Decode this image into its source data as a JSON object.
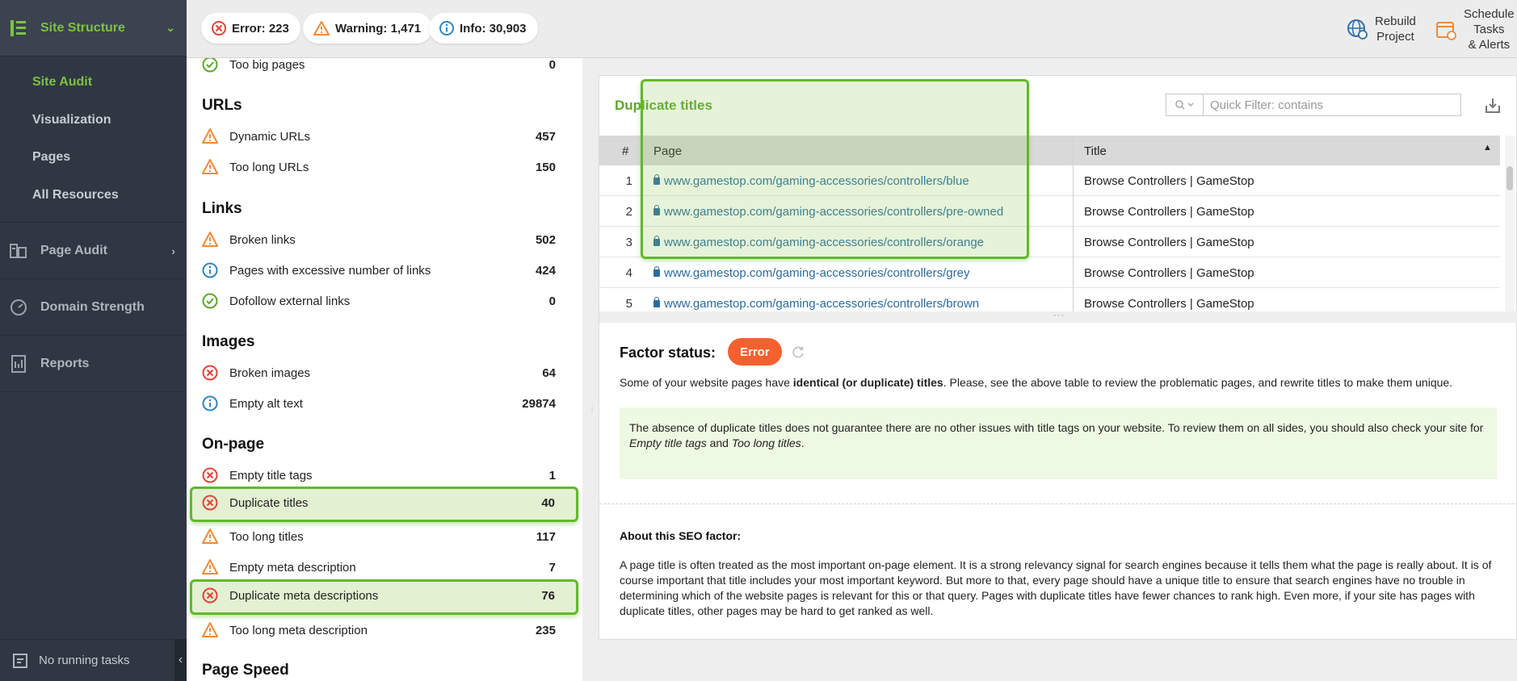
{
  "nav": {
    "site_structure": "Site Structure",
    "subs": [
      "Site Audit",
      "Visualization",
      "Pages",
      "All Resources"
    ],
    "page_audit": "Page Audit",
    "domain_strength": "Domain Strength",
    "reports": "Reports",
    "footer": "No running tasks"
  },
  "topbar": {
    "error": "Error: 223",
    "warning": "Warning: 1,471",
    "info": "Info: 30,903",
    "rebuild_l1": "Rebuild",
    "rebuild_l2": "Project",
    "schedule_l1": "Schedule",
    "schedule_l2": "Tasks",
    "schedule_l3": "& Alerts"
  },
  "factors": {
    "too_big": {
      "label": "Too big pages",
      "value": "0"
    },
    "urls": "URLs",
    "dynamic_urls": {
      "label": "Dynamic URLs",
      "value": "457"
    },
    "long_urls": {
      "label": "Too long URLs",
      "value": "150"
    },
    "links": "Links",
    "broken_links": {
      "label": "Broken links",
      "value": "502"
    },
    "excessive_links": {
      "label": "Pages with excessive number of links",
      "value": "424"
    },
    "dofollow": {
      "label": "Dofollow external links",
      "value": "0"
    },
    "images": "Images",
    "broken_images": {
      "label": "Broken images",
      "value": "64"
    },
    "empty_alt": {
      "label": "Empty alt text",
      "value": "29874"
    },
    "onpage": "On-page",
    "empty_title": {
      "label": "Empty title tags",
      "value": "1"
    },
    "dup_titles": {
      "label": "Duplicate titles",
      "value": "40"
    },
    "long_titles": {
      "label": "Too long titles",
      "value": "117"
    },
    "empty_meta": {
      "label": "Empty meta description",
      "value": "7"
    },
    "dup_meta": {
      "label": "Duplicate meta descriptions",
      "value": "76"
    },
    "long_meta": {
      "label": "Too long meta description",
      "value": "235"
    },
    "page_speed": "Page Speed"
  },
  "detail": {
    "title": "Duplicate titles",
    "filter_placeholder": "Quick Filter: contains",
    "col_num": "#",
    "col_page": "Page",
    "col_title": "Title",
    "rows": [
      {
        "n": "1",
        "page": "www.gamestop.com/gaming-accessories/controllers/blue",
        "title": "Browse Controllers | GameStop"
      },
      {
        "n": "2",
        "page": "www.gamestop.com/gaming-accessories/controllers/pre-owned",
        "title": "Browse Controllers | GameStop"
      },
      {
        "n": "3",
        "page": "www.gamestop.com/gaming-accessories/controllers/orange",
        "title": "Browse Controllers | GameStop"
      },
      {
        "n": "4",
        "page": "www.gamestop.com/gaming-accessories/controllers/grey",
        "title": "Browse Controllers | GameStop"
      },
      {
        "n": "5",
        "page": "www.gamestop.com/gaming-accessories/controllers/brown",
        "title": "Browse Controllers | GameStop"
      }
    ],
    "factor_status_label": "Factor status:",
    "factor_status": "Error",
    "status_text_1": "Some of your website pages have ",
    "status_text_bold": "identical (or duplicate) titles",
    "status_text_2": ". Please, see the above table to review the problematic pages, and rewrite titles to make them unique.",
    "tip_1": "The absence of duplicate titles does not guarantee there are no other issues with title tags on your website. To review them on all sides, you should also check your site for ",
    "tip_em1": "Empty title tags",
    "tip_and": " and ",
    "tip_em2": "Too long titles",
    "tip_end": ".",
    "about_title": "About this SEO factor:",
    "about_text": "A page title is often treated as the most important on-page element. It is a strong relevancy signal for search engines because it tells them what the page is really about. It is of course important that title includes your most important keyword. But more to that, every page should have a unique title to ensure that search engines have no trouble in determining which of the website pages is relevant for this or that query. Pages with duplicate titles have fewer chances to rank high. Even more, if your site has pages with duplicate titles, other pages may be hard to get ranked as well."
  },
  "colors": {
    "accent_green": "#7cc242",
    "error_red": "#e0443a",
    "warning_orange": "#f08a38",
    "info_blue": "#2f86c6",
    "nav_bg": "#2f3742"
  }
}
